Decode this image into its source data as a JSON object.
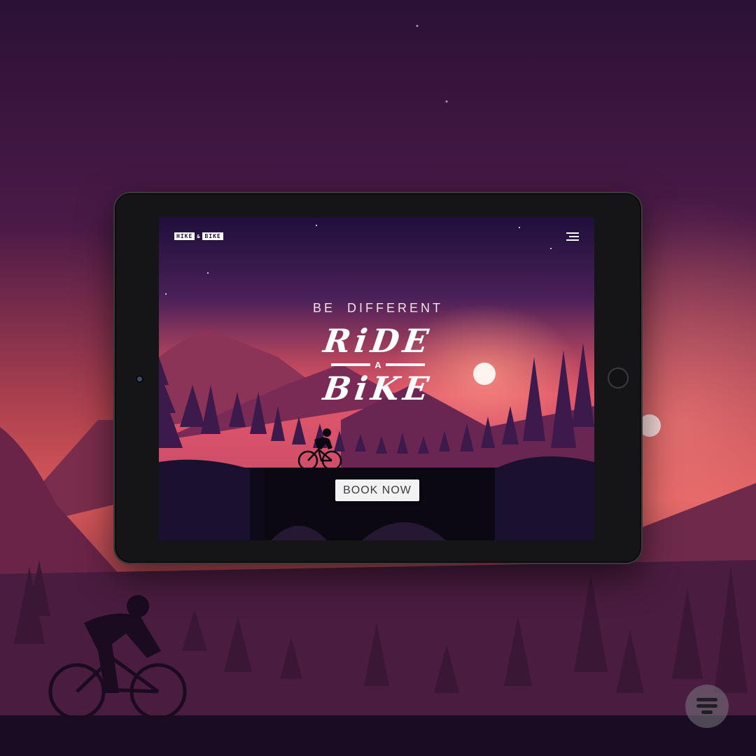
{
  "site": {
    "logo_word_1": "HIKE",
    "logo_amp": "&",
    "logo_word_2": "BIKE"
  },
  "hero": {
    "tagline": "BE DIFFERENT",
    "headline_line_1": "RiDE",
    "headline_connector": "A",
    "headline_line_2": "BiKE",
    "cta_label": "BOOK NOW"
  },
  "icons": {
    "menu": "hamburger-menu-icon",
    "badge": "brand-badge-icon"
  },
  "colors": {
    "sky_top": "#1e0f3c",
    "sky_glow": "#e0576a",
    "moon": "#fff3ee",
    "button_bg": "#f2f2f2"
  }
}
